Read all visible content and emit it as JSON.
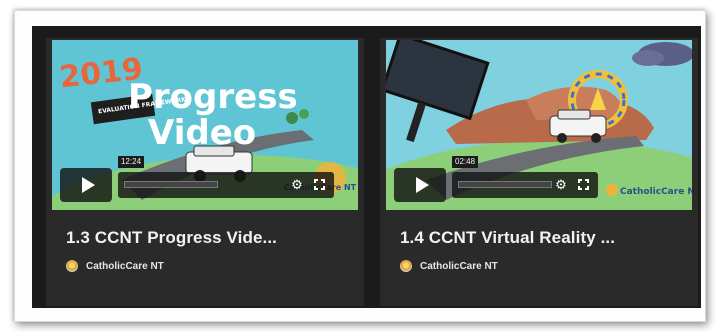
{
  "videos": [
    {
      "title": "1.3 CCNT Progress Vide...",
      "author": "CatholicCare NT",
      "duration": "12:24",
      "thumbnail_text": {
        "year": "2019",
        "headline_1": "Progress",
        "headline_2": "Video",
        "sign": "EVALUATION FRAMEWORK",
        "logo": "CatholicCare NT"
      }
    },
    {
      "title": "1.4 CCNT Virtual Reality ...",
      "author": "CatholicCare NT",
      "duration": "02:48",
      "thumbnail_text": {
        "logo": "CatholicCare NT"
      }
    }
  ],
  "icons": {
    "play": "play-icon",
    "settings": "gear-icon",
    "fullscreen": "fullscreen-icon",
    "avatar": "catholiccare-logo-icon"
  },
  "colors": {
    "card_bg": "#2a2a2a",
    "strip_bg": "#1b1b1b",
    "year_orange": "#e8663b",
    "sky": "#5fc5d4",
    "hill": "#8ccf78"
  }
}
